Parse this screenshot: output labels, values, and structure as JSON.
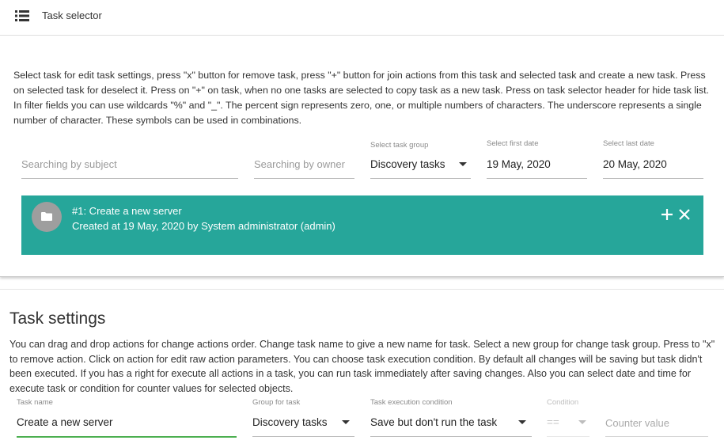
{
  "header": {
    "title": "Task selector",
    "icon": "list-icon"
  },
  "selector": {
    "description": "Select task for edit task settings, press \"x\" button for remove task, press \"+\" button for join actions from this task and selected task and create a new task. Press on selected task for deselect it. Press on \"+\" on task, when no one tasks are selected to copy task as a new task. Press on task selector header for hide task list. In filter fields you can use wildcards \"%\" and \"_\". The percent sign represents zero, one, or multiple numbers of characters. The underscore represents a single number of character. These symbols can be used in combinations.",
    "filters": {
      "subject_placeholder": "Searching by subject",
      "owner_placeholder": "Searching by owner",
      "group_label": "Select task group",
      "group_value": "Discovery tasks",
      "first_date_label": "Select first date",
      "first_date_value": "19 May, 2020",
      "last_date_label": "Select last date",
      "last_date_value": "20 May, 2020"
    },
    "tasks": [
      {
        "title": "#1: Create a new server",
        "subtitle": "Created at 19 May, 2020 by System administrator (admin)",
        "icon": "folder-icon",
        "background": "#26a69a"
      }
    ]
  },
  "settings": {
    "title": "Task settings",
    "description": "You can drag and drop actions for change actions order. Change task name to give a new name for task. Select a new group for change task group. Press to \"x\" to remove action. Click on action for edit raw action parameters. You can choose task execution condition. By default all changes will be saving but task didn't been executed. If you has a right for execute all actions in a task, you can run task immediately after saving changes. Also you can select date and time for execute task or condition for counter values for selected objects.",
    "task_name_label": "Task name",
    "task_name_value": "Create a new server",
    "group_label": "Group for task",
    "group_value": "Discovery tasks",
    "condition_label": "Task execution condition",
    "condition_value": "Save but don't run the task",
    "operator_label": "Condition",
    "operator_value": "==",
    "counter_placeholder": "Counter value",
    "accent": "#4caf50"
  }
}
